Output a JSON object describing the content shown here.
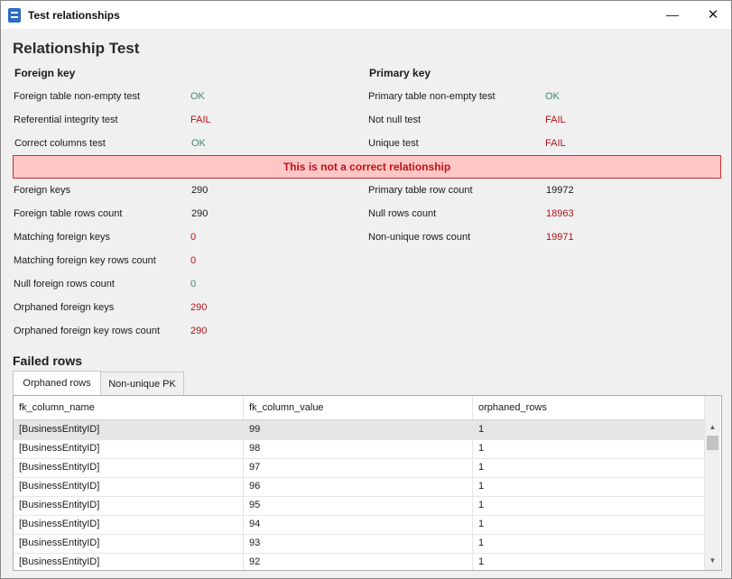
{
  "window": {
    "title": "Test relationships",
    "minimize": "—",
    "close": "✕"
  },
  "heading": "Relationship Test",
  "foreign_key": {
    "title": "Foreign key",
    "tests": [
      {
        "label": "Foreign table non-empty test",
        "result": "OK"
      },
      {
        "label": "Referential integrity test",
        "result": "FAIL"
      },
      {
        "label": "Correct columns test",
        "result": "OK"
      }
    ],
    "stats": [
      {
        "label": "Foreign keys",
        "value": "290"
      },
      {
        "label": "Foreign table rows count",
        "value": "290"
      },
      {
        "label": "Matching foreign keys",
        "value": "0"
      },
      {
        "label": "Matching foreign key rows count",
        "value": "0"
      },
      {
        "label": "Null foreign rows count",
        "value": "0"
      },
      {
        "label": "Orphaned foreign keys",
        "value": "290"
      },
      {
        "label": "Orphaned foreign key rows count",
        "value": "290"
      }
    ]
  },
  "primary_key": {
    "title": "Primary key",
    "tests": [
      {
        "label": "Primary table non-empty test",
        "result": "OK"
      },
      {
        "label": "Not null test",
        "result": "FAIL"
      },
      {
        "label": "Unique test",
        "result": "FAIL"
      }
    ],
    "stats": [
      {
        "label": "Primary table row count",
        "value": "19972"
      },
      {
        "label": "Null rows count",
        "value": "18963"
      },
      {
        "label": "Non-unique rows count",
        "value": "19971"
      }
    ]
  },
  "banner": "This is not a correct relationship",
  "failed_rows": {
    "title": "Failed rows",
    "tabs": [
      "Orphaned rows",
      "Non-unique PK"
    ],
    "columns": [
      "fk_column_name",
      "fk_column_value",
      "orphaned_rows"
    ],
    "rows": [
      [
        "[BusinessEntityID]",
        "99",
        "1"
      ],
      [
        "[BusinessEntityID]",
        "98",
        "1"
      ],
      [
        "[BusinessEntityID]",
        "97",
        "1"
      ],
      [
        "[BusinessEntityID]",
        "96",
        "1"
      ],
      [
        "[BusinessEntityID]",
        "95",
        "1"
      ],
      [
        "[BusinessEntityID]",
        "94",
        "1"
      ],
      [
        "[BusinessEntityID]",
        "93",
        "1"
      ],
      [
        "[BusinessEntityID]",
        "92",
        "1"
      ]
    ],
    "scroll_up": "▲",
    "scroll_down": "▼"
  },
  "colors": {
    "ok": "#3c8a68",
    "fail": "#b3121b",
    "banner_bg": "#ffc6c6",
    "banner_border": "#c52f36"
  }
}
